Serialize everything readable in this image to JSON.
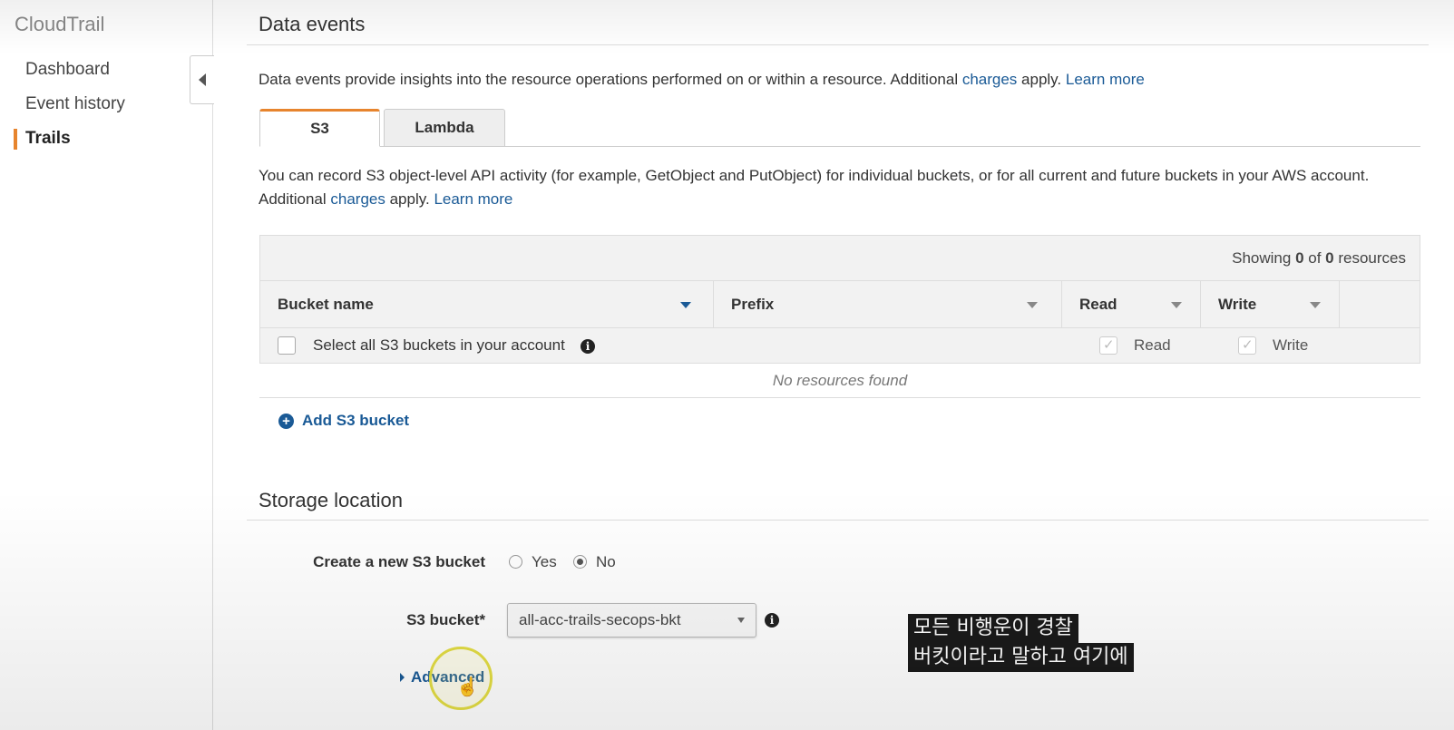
{
  "sidebar": {
    "brand": "CloudTrail",
    "items": [
      {
        "label": "Dashboard"
      },
      {
        "label": "Event history"
      },
      {
        "label": "Trails"
      }
    ]
  },
  "data_events": {
    "title": "Data events",
    "desc_prefix": "Data events provide insights into the resource operations performed on or within a resource. Additional ",
    "charges_link": "charges",
    "desc_mid": " apply. ",
    "learn_more": "Learn more",
    "tabs": [
      {
        "label": "S3"
      },
      {
        "label": "Lambda"
      }
    ],
    "s3_desc_line1": "You can record S3 object-level API activity (for example, GetObject and PutObject) for individual buckets, or for all current and future buckets in your AWS account.",
    "s3_desc_line2_prefix": "Additional ",
    "s3_desc_line2_mid": " apply. "
  },
  "table": {
    "showing_prefix": "Showing ",
    "showing_count": "0",
    "showing_of": " of ",
    "showing_total": "0",
    "showing_suffix": " resources",
    "columns": [
      "Bucket name",
      "Prefix",
      "Read",
      "Write"
    ],
    "select_all_label": "Select all S3 buckets in your account",
    "read_label": "Read",
    "write_label": "Write",
    "empty": "No resources found",
    "add_button": "Add S3 bucket"
  },
  "storage": {
    "title": "Storage location",
    "create_label": "Create a new S3 bucket",
    "yes": "Yes",
    "no": "No",
    "selected": "No",
    "bucket_label": "S3 bucket*",
    "bucket_value": "all-acc-trails-secops-bkt",
    "advanced": "Advanced"
  },
  "subtitle": {
    "line1": "모든 비행운이 경찰",
    "line2": "버킷이라고 말하고 여기에"
  },
  "colors": {
    "accent": "#e7842d",
    "link": "#1a5a96"
  },
  "icons": [
    "collapse-left-icon",
    "info-icon",
    "plus-circle-icon",
    "sort-caret-icon",
    "caret-right-icon",
    "hand-pointer-icon"
  ]
}
